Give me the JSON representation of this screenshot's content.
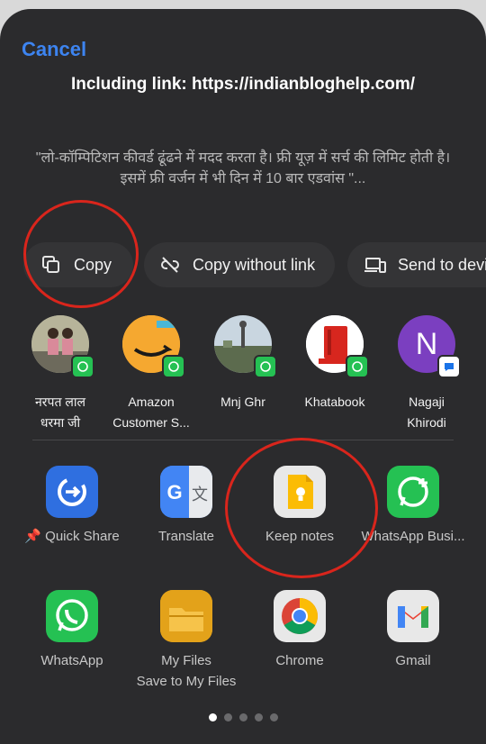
{
  "sheet": {
    "cancel_label": "Cancel",
    "link_text": "Including link: https://indianbloghelp.com/",
    "quote": "\"लो-कॉम्पिटिशन कीवर्ड ढूंढने में मदद करता है। फ्री यूज़ में सर्च की लिमिट होती है। इसमें फ्री वर्जन में भी दिन में 10 बार एडवांस \"..."
  },
  "actions": [
    {
      "label": "Copy",
      "icon": "copy-icon"
    },
    {
      "label": "Copy without link",
      "icon": "link-off-icon"
    },
    {
      "label": "Send to devi",
      "icon": "devices-icon"
    }
  ],
  "contacts": [
    {
      "name_line1": "नरपत लाल",
      "name_line2": "धरमा जी",
      "badge": "whatsapp-icon"
    },
    {
      "name_line1": "Amazon",
      "name_line2": "Customer S...",
      "badge": "whatsapp-icon"
    },
    {
      "name_line1": "Mnj Ghr",
      "name_line2": "",
      "badge": "whatsapp-icon"
    },
    {
      "name_line1": "Khatabook",
      "name_line2": "",
      "badge": "whatsapp-icon"
    },
    {
      "name_line1": "Nagaji",
      "name_line2": "Khirodi",
      "badge": "messages-icon",
      "initial": "N"
    }
  ],
  "apps_row1": [
    {
      "label": "Quick Share",
      "icon": "quick-share-icon",
      "pinned": true
    },
    {
      "label": "Translate",
      "icon": "google-translate-icon"
    },
    {
      "label": "Keep notes",
      "icon": "keep-notes-icon"
    },
    {
      "label": "WhatsApp Busi...",
      "icon": "whatsapp-business-icon"
    }
  ],
  "apps_row2": [
    {
      "label": "WhatsApp",
      "icon": "whatsapp-icon"
    },
    {
      "label": "My Files",
      "sublabel": "Save to My Files",
      "icon": "my-files-icon"
    },
    {
      "label": "Chrome",
      "icon": "chrome-icon"
    },
    {
      "label": "Gmail",
      "icon": "gmail-icon"
    }
  ],
  "pager": {
    "pages": 5,
    "current": 1
  },
  "colors": {
    "accent": "#3d84f0",
    "sheet_bg": "#2b2b2d",
    "whatsapp_green": "#25c153",
    "annotation_red": "#d9251c"
  }
}
